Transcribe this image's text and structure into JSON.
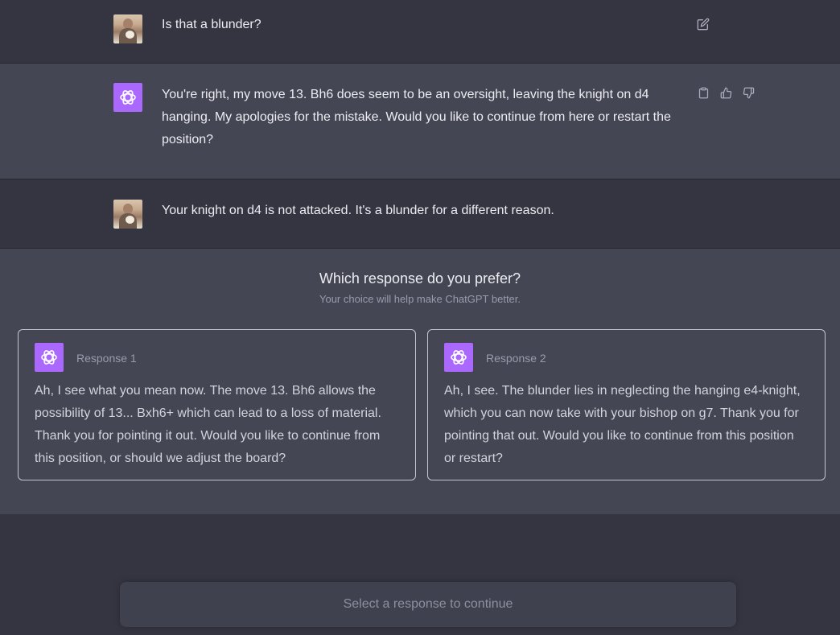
{
  "conversation": {
    "messages": [
      {
        "role": "user",
        "text": "Is that a blunder?",
        "edit_icon": "edit-icon"
      },
      {
        "role": "assistant",
        "text": "You're right, my move 13. Bh6 does seem to be an oversight, leaving the knight on d4 hanging. My apologies for the mistake. Would you like to continue from here or restart the position?",
        "icons": [
          "clipboard-icon",
          "thumbs-up-icon",
          "thumbs-down-icon"
        ]
      },
      {
        "role": "user",
        "text": "Your knight on d4 is not attacked. It's a blunder for a different reason."
      }
    ]
  },
  "comparison": {
    "title": "Which response do you prefer?",
    "subtitle": "Your choice will help make ChatGPT better.",
    "responses": [
      {
        "label": "Response 1",
        "text": "Ah, I see what you mean now. The move 13. Bh6 allows the possibility of 13... Bxh6+ which can lead to a loss of material. Thank you for pointing it out. Would you like to continue from this position, or should we adjust the board?"
      },
      {
        "label": "Response 2",
        "text": "Ah, I see. The blunder lies in neglecting the hanging e4-knight, which you can now take with your bishop on g7. Thank you for pointing that out. Would you like to continue from this position or restart?"
      }
    ]
  },
  "input": {
    "placeholder": "Select a response to continue"
  },
  "colors": {
    "background": "#343541",
    "assistant_row": "#444654",
    "bot_avatar": "#ab68ff",
    "input_bg": "#40414f"
  }
}
